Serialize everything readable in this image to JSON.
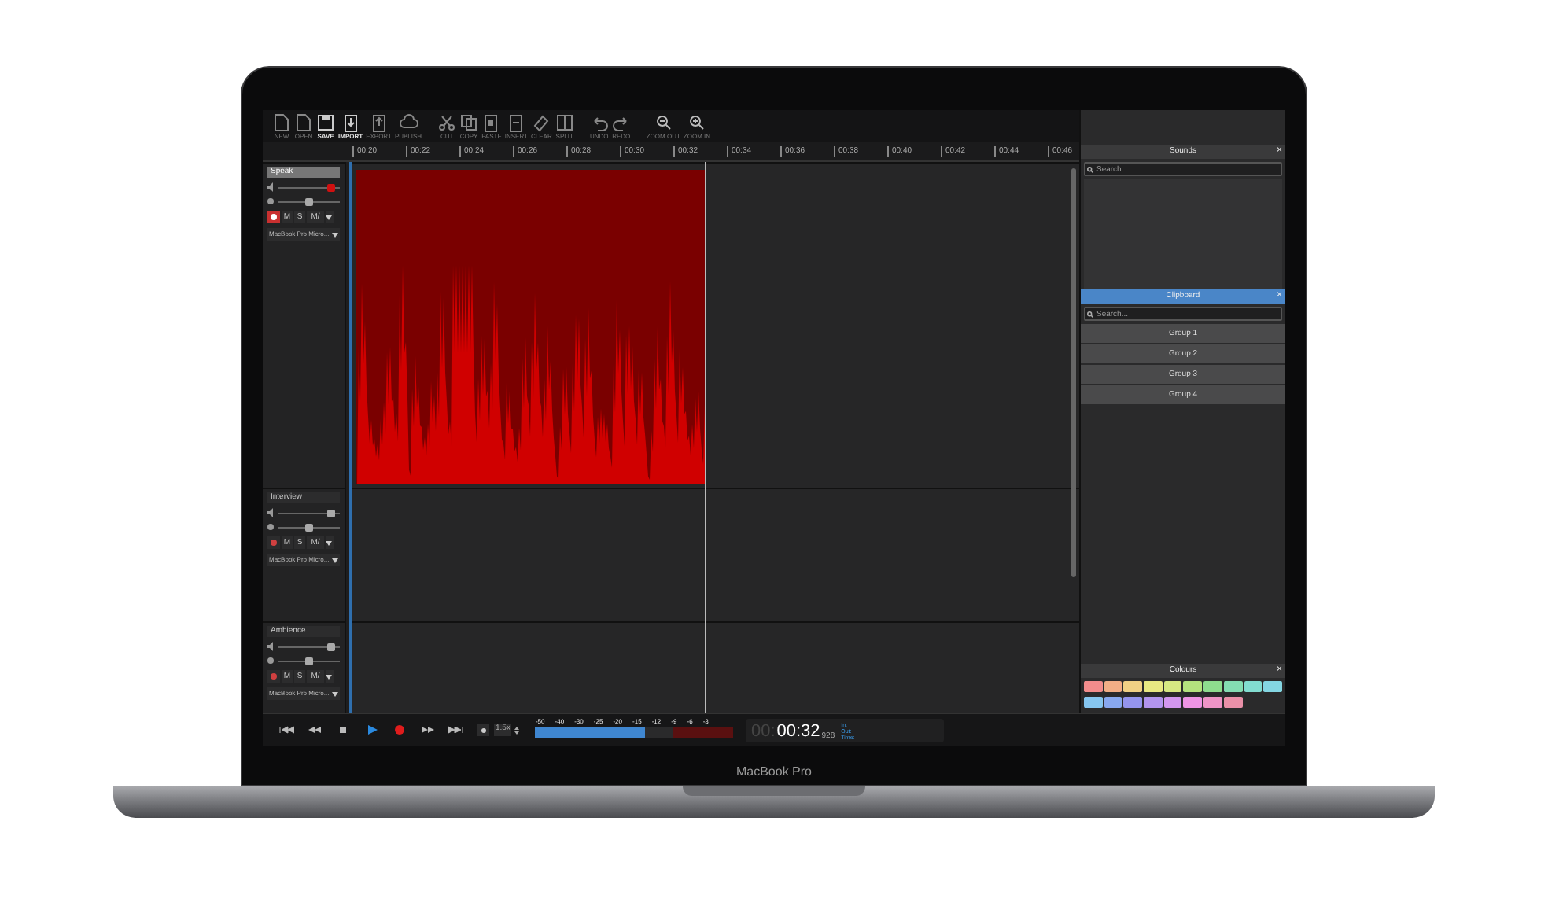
{
  "device": {
    "label": "MacBook Pro"
  },
  "toolbar": [
    {
      "label": "NEW",
      "enabled": false
    },
    {
      "label": "OPEN",
      "enabled": false
    },
    {
      "label": "SAVE",
      "enabled": true
    },
    {
      "label": "IMPORT",
      "enabled": true
    },
    {
      "label": "EXPORT",
      "enabled": false
    },
    {
      "label": "PUBLISH",
      "enabled": false
    },
    {
      "label": "CUT",
      "enabled": false
    },
    {
      "label": "COPY",
      "enabled": false
    },
    {
      "label": "PASTE",
      "enabled": false
    },
    {
      "label": "INSERT",
      "enabled": false
    },
    {
      "label": "CLEAR",
      "enabled": false
    },
    {
      "label": "SPLIT",
      "enabled": false
    },
    {
      "label": "UNDO",
      "enabled": false
    },
    {
      "label": "REDO",
      "enabled": false
    },
    {
      "label": "ZOOM OUT",
      "enabled": false
    },
    {
      "label": "ZOOM IN",
      "enabled": false
    }
  ],
  "ruler": [
    "00:20",
    "00:22",
    "00:24",
    "00:26",
    "00:28",
    "00:30",
    "00:32",
    "00:34",
    "00:36",
    "00:38",
    "00:40",
    "00:42",
    "00:44",
    "00:46"
  ],
  "tracks": [
    {
      "name": "Speak",
      "selected": true,
      "volume": {
        "level": 0.85
      },
      "pan": {
        "level": 0.5
      },
      "record_armed": true,
      "buttons": [
        "M",
        "S",
        "M/"
      ],
      "input": "MacBook Pro Micro...",
      "has_audio": true
    },
    {
      "name": "Interview",
      "selected": false,
      "volume": {
        "level": 0.85
      },
      "pan": {
        "level": 0.5
      },
      "record_armed": false,
      "buttons": [
        "M",
        "S",
        "M/"
      ],
      "input": "MacBook Pro Micro...",
      "has_audio": false
    },
    {
      "name": "Ambience",
      "selected": false,
      "volume": {
        "level": 0.85
      },
      "pan": {
        "level": 0.5
      },
      "record_armed": false,
      "buttons": [
        "M",
        "S",
        "M/"
      ],
      "input": "MacBook Pro Micro...",
      "has_audio": false
    }
  ],
  "panels": {
    "sounds": {
      "title": "Sounds",
      "close": "×",
      "search": {
        "placeholder": "Search..."
      },
      "selected": false
    },
    "clipboard": {
      "title": "Clipboard",
      "close": "×",
      "search": {
        "placeholder": "Search..."
      },
      "selected": true,
      "groups": [
        "Group 1",
        "Group 2",
        "Group 3",
        "Group 4"
      ]
    },
    "colours": {
      "title": "Colours",
      "close": "×",
      "swatches": [
        {
          "color": "#f28c8c"
        },
        {
          "color": "#f2ae86"
        },
        {
          "color": "#f0d084"
        },
        {
          "color": "#e8e882"
        },
        {
          "color": "#d6e882"
        },
        {
          "color": "#b4e27e"
        },
        {
          "color": "#8edc8e"
        },
        {
          "color": "#84dcb2"
        },
        {
          "color": "#82dcd0"
        },
        {
          "color": "#84d6e2"
        },
        {
          "color": "#86c6f0"
        },
        {
          "color": "#88a8f0"
        },
        {
          "color": "#9494ee"
        },
        {
          "color": "#b294ee"
        },
        {
          "color": "#d296ee"
        },
        {
          "color": "#ee94e4"
        },
        {
          "color": "#ee94c6"
        },
        {
          "color": "#ea90a8"
        }
      ]
    }
  },
  "transport": {
    "speed": "1.5x",
    "meter": {
      "scale": [
        "-50",
        "-40",
        "-30",
        "-25",
        "-20",
        "-15",
        "-12",
        "-9",
        "-6",
        "-3"
      ],
      "level": 0.55
    },
    "timecode": {
      "hours": "00:",
      "time": "00:32",
      "millis": "928"
    },
    "markers": [
      "In:",
      "Out:",
      "Time:"
    ]
  }
}
